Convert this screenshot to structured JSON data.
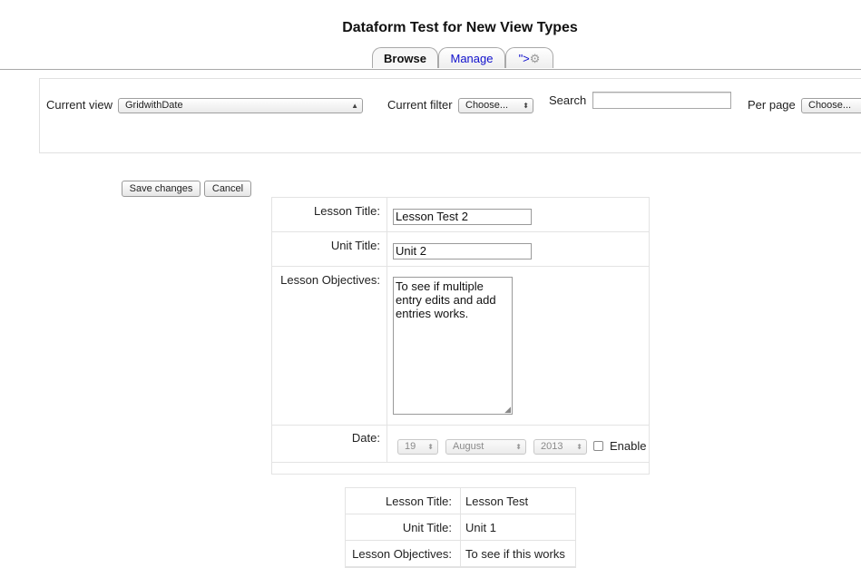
{
  "header": {
    "title": "Dataform Test for New View Types"
  },
  "tabs": {
    "browse": "Browse",
    "manage": "Manage",
    "gear_prefix": "\">",
    "gear_icon": "gear-icon"
  },
  "filters": {
    "current_view_label": "Current view",
    "current_view_value": "GridwithDate",
    "current_filter_label": "Current filter",
    "current_filter_value": "Choose...",
    "search_label": "Search",
    "search_value": "",
    "per_page_label": "Per page",
    "per_page_value": "Choose..."
  },
  "actions": {
    "save": "Save changes",
    "cancel": "Cancel"
  },
  "edit_entry": {
    "lesson_title_label": "Lesson Title:",
    "lesson_title_value": "Lesson Test 2",
    "unit_title_label": "Unit Title:",
    "unit_title_value": "Unit 2",
    "objectives_label": "Lesson Objectives:",
    "objectives_value": "To see if multiple entry edits and add entries works.",
    "date_label": "Date:",
    "day": "19",
    "month": "August",
    "year": "2013",
    "enable_label": "Enable",
    "enable_checked": false
  },
  "view_entry": {
    "rows": [
      {
        "label": "Lesson Title:",
        "value": "Lesson Test"
      },
      {
        "label": "Unit Title:",
        "value": "Unit 1"
      },
      {
        "label": "Lesson Objectives:",
        "value": "To see if this works"
      }
    ]
  },
  "colors": {
    "link": "#1010cc",
    "border": "#e3e3e3"
  }
}
